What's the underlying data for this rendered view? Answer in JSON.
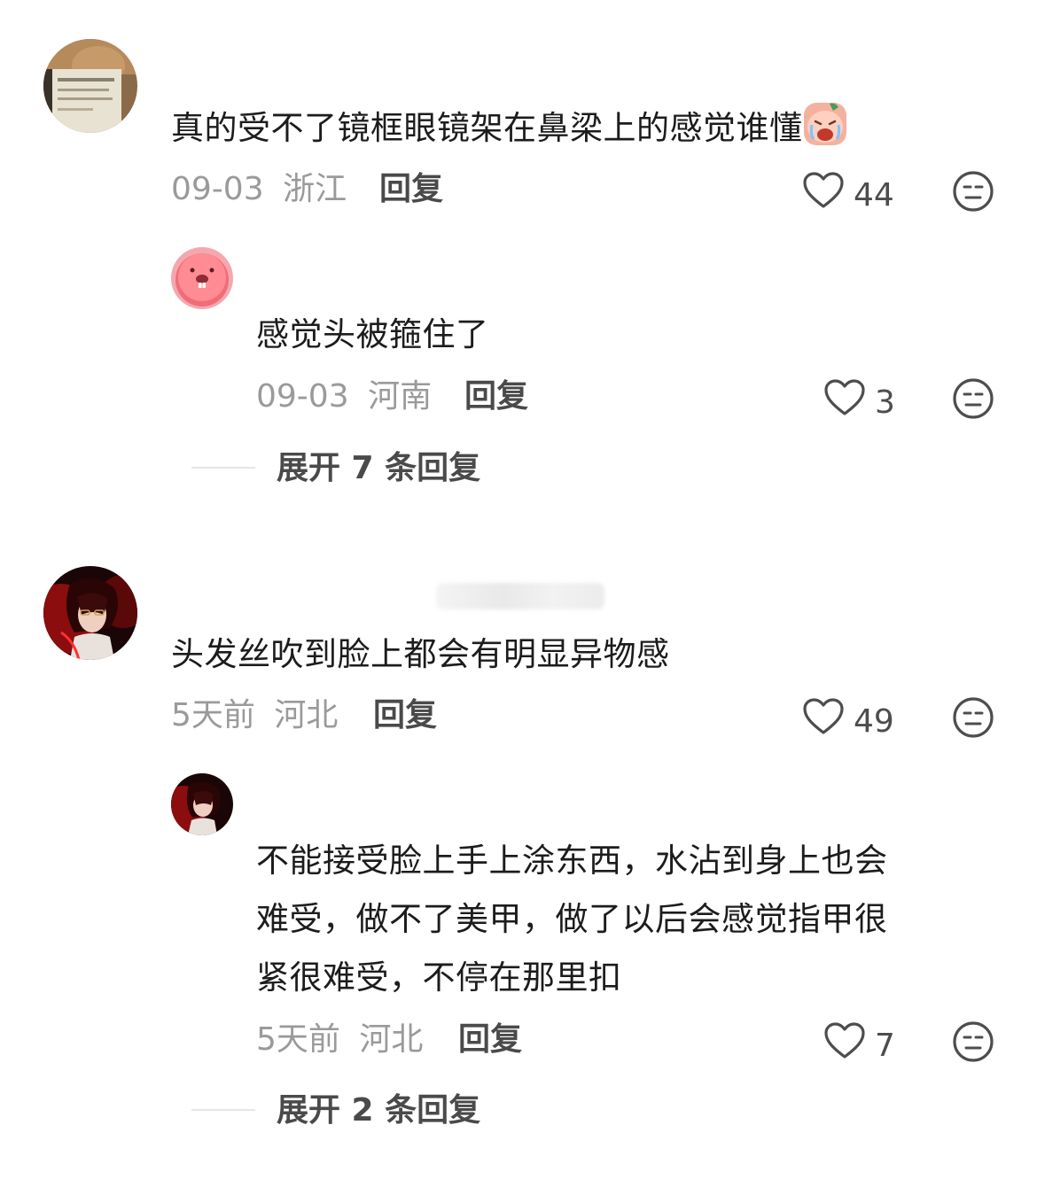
{
  "comments": [
    {
      "text": "真的受不了镜框眼镜架在鼻梁上的感觉谁懂",
      "emoji": "crying-face-emoji",
      "date": "09-03",
      "location": "浙江",
      "reply_label": "回复",
      "likes": "44",
      "replies": [
        {
          "text": "感觉头被箍住了",
          "date": "09-03",
          "location": "河南",
          "reply_label": "回复",
          "likes": "3"
        }
      ],
      "expand_label": "展开 7 条回复"
    },
    {
      "text": "头发丝吹到脸上都会有明显异物感",
      "date": "5天前",
      "location": "河北",
      "reply_label": "回复",
      "likes": "49",
      "replies": [
        {
          "text_lines": [
            "不能接受脸上手上涂东西，水沾到身上也会",
            "难受，做不了美甲，做了以后会感觉指甲很",
            "紧很难受，不停在那里扣"
          ],
          "date": "5天前",
          "location": "河北",
          "reply_label": "回复",
          "likes": "7"
        }
      ],
      "expand_label": "展开 2 条回复"
    }
  ],
  "icons": {
    "like": "heart-outline-icon",
    "dislike": "neutral-face-icon"
  },
  "colors": {
    "text": "#1c1c1c",
    "meta": "#9a9a9a",
    "action": "#4a4a4a"
  }
}
